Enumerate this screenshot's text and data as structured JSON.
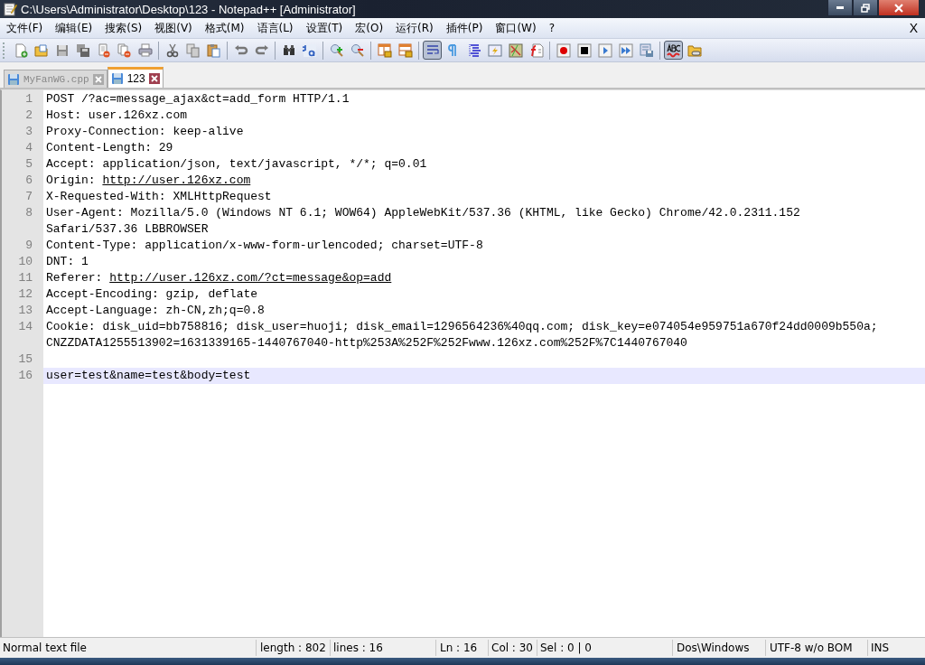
{
  "window": {
    "title": "C:\\Users\\Administrator\\Desktop\\123 - Notepad++ [Administrator]"
  },
  "menu": {
    "items": [
      "文件(F)",
      "编辑(E)",
      "搜索(S)",
      "视图(V)",
      "格式(M)",
      "语言(L)",
      "设置(T)",
      "宏(O)",
      "运行(R)",
      "插件(P)",
      "窗口(W)",
      "?"
    ],
    "close": "X"
  },
  "toolbar": [
    {
      "kind": "new",
      "pressed": false
    },
    {
      "kind": "open",
      "pressed": false
    },
    {
      "kind": "save",
      "pressed": false
    },
    {
      "kind": "save-all",
      "pressed": false
    },
    {
      "kind": "close",
      "pressed": false
    },
    {
      "kind": "close-all",
      "pressed": false
    },
    {
      "kind": "print",
      "pressed": false
    },
    {
      "kind": "separator"
    },
    {
      "kind": "cut",
      "pressed": false
    },
    {
      "kind": "copy",
      "pressed": false
    },
    {
      "kind": "paste",
      "pressed": false
    },
    {
      "kind": "separator"
    },
    {
      "kind": "undo",
      "pressed": false
    },
    {
      "kind": "redo",
      "pressed": false
    },
    {
      "kind": "separator"
    },
    {
      "kind": "find",
      "pressed": false
    },
    {
      "kind": "replace",
      "pressed": false
    },
    {
      "kind": "separator"
    },
    {
      "kind": "zoom-in",
      "pressed": false
    },
    {
      "kind": "zoom-out",
      "pressed": false
    },
    {
      "kind": "separator"
    },
    {
      "kind": "sync-vertical",
      "pressed": false
    },
    {
      "kind": "sync-horizontal",
      "pressed": false
    },
    {
      "kind": "separator"
    },
    {
      "kind": "word-wrap",
      "pressed": true
    },
    {
      "kind": "pilcrow",
      "pressed": false
    },
    {
      "kind": "indent-guide",
      "pressed": false
    },
    {
      "kind": "lightning",
      "pressed": false
    },
    {
      "kind": "map",
      "pressed": false
    },
    {
      "kind": "function",
      "pressed": false
    },
    {
      "kind": "separator"
    },
    {
      "kind": "record",
      "pressed": false
    },
    {
      "kind": "stop",
      "pressed": false
    },
    {
      "kind": "play",
      "pressed": false
    },
    {
      "kind": "play-multiple",
      "pressed": false
    },
    {
      "kind": "save-macro",
      "pressed": false
    },
    {
      "kind": "separator"
    },
    {
      "kind": "spellcheck",
      "pressed": true
    },
    {
      "kind": "folder",
      "pressed": false
    }
  ],
  "tabs": [
    {
      "label": "MyFanWG.cpp",
      "selected": false
    },
    {
      "label": "123",
      "selected": true
    }
  ],
  "editor": {
    "lines": [
      {
        "number": "1",
        "current": false,
        "rows": [
          [
            {
              "kind": "text",
              "text": "POST /?ac=message_ajax&ct=add_form HTTP/1.1"
            }
          ]
        ]
      },
      {
        "number": "2",
        "current": false,
        "rows": [
          [
            {
              "kind": "text",
              "text": "Host: user.126xz.com"
            }
          ]
        ]
      },
      {
        "number": "3",
        "current": false,
        "rows": [
          [
            {
              "kind": "text",
              "text": "Proxy-Connection: keep-alive"
            }
          ]
        ]
      },
      {
        "number": "4",
        "current": false,
        "rows": [
          [
            {
              "kind": "text",
              "text": "Content-Length: 29"
            }
          ]
        ]
      },
      {
        "number": "5",
        "current": false,
        "rows": [
          [
            {
              "kind": "text",
              "text": "Accept: application/json, text/javascript, */*; q=0.01"
            }
          ]
        ]
      },
      {
        "number": "6",
        "current": false,
        "rows": [
          [
            {
              "kind": "text",
              "text": "Origin: "
            },
            {
              "kind": "link",
              "text": "http://user.126xz.com"
            }
          ]
        ]
      },
      {
        "number": "7",
        "current": false,
        "rows": [
          [
            {
              "kind": "text",
              "text": "X-Requested-With: XMLHttpRequest"
            }
          ]
        ]
      },
      {
        "number": "8",
        "current": false,
        "rows": [
          [
            {
              "kind": "text",
              "text": "User-Agent: Mozilla/5.0 (Windows NT 6.1; WOW64) AppleWebKit/537.36 (KHTML, like Gecko) Chrome/42.0.2311.152"
            }
          ],
          [
            {
              "kind": "text",
              "text": "Safari/537.36 LBBROWSER"
            }
          ]
        ]
      },
      {
        "number": "9",
        "current": false,
        "rows": [
          [
            {
              "kind": "text",
              "text": "Content-Type: application/x-www-form-urlencoded; charset=UTF-8"
            }
          ]
        ]
      },
      {
        "number": "10",
        "current": false,
        "rows": [
          [
            {
              "kind": "text",
              "text": "DNT: 1"
            }
          ]
        ]
      },
      {
        "number": "11",
        "current": false,
        "rows": [
          [
            {
              "kind": "text",
              "text": "Referer: "
            },
            {
              "kind": "link",
              "text": "http://user.126xz.com/?ct=message&op=add"
            }
          ]
        ]
      },
      {
        "number": "12",
        "current": false,
        "rows": [
          [
            {
              "kind": "text",
              "text": "Accept-Encoding: gzip, deflate"
            }
          ]
        ]
      },
      {
        "number": "13",
        "current": false,
        "rows": [
          [
            {
              "kind": "text",
              "text": "Accept-Language: zh-CN,zh;q=0.8"
            }
          ]
        ]
      },
      {
        "number": "14",
        "current": false,
        "rows": [
          [
            {
              "kind": "text",
              "text": "Cookie: disk_uid=bb758816; disk_user=huoji; disk_email=1296564236%40qq.com; disk_key=e074054e959751a670f24dd0009b550a;"
            }
          ],
          [
            {
              "kind": "text",
              "text": "CNZZDATA1255513902=1631339165-1440767040-http%253A%252F%252Fwww.126xz.com%252F%7C1440767040"
            }
          ]
        ]
      },
      {
        "number": "15",
        "current": false,
        "rows": [
          []
        ]
      },
      {
        "number": "16",
        "current": true,
        "rows": [
          [
            {
              "kind": "text",
              "text": "user=test&name=test&body=test"
            }
          ]
        ]
      }
    ]
  },
  "status_bar": {
    "file_type": "Normal text file",
    "length": "length : 802",
    "lines": "lines : 16",
    "ln": "Ln : 16",
    "col": "Col : 30",
    "sel": "Sel : 0 | 0",
    "eol": "Dos\\Windows",
    "encoding": "UTF-8 w/o BOM",
    "mode": "INS"
  }
}
